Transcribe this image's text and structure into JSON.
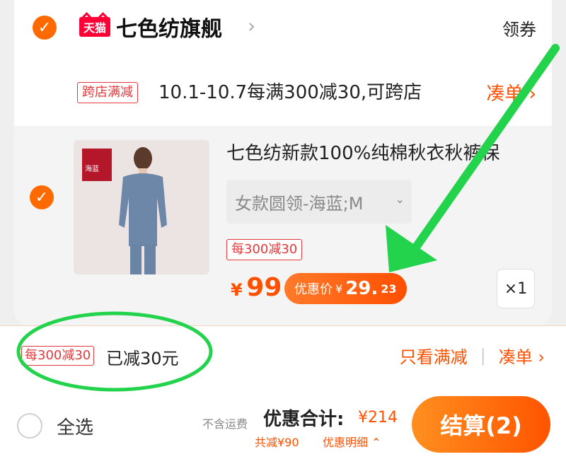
{
  "store": {
    "platform_logo": "天猫",
    "name": "七色纺旗舰",
    "coupon_label": "领券"
  },
  "promotion": {
    "tag": "跨店满减",
    "text": "10.1-10.7每满300减30,可跨店",
    "link_label": "凑单"
  },
  "item": {
    "thumb_badge": "海蓝",
    "title": "七色纺新款100%纯棉秋衣秋裤保",
    "variant": "女款圆领-海蓝;M",
    "promo_tag": "每300减30",
    "price_symbol": "¥",
    "price": "99",
    "promo_price_label": "优惠价",
    "promo_price_symbol": "¥",
    "promo_price_int": "29.",
    "promo_price_dec": "23",
    "quantity": "×1"
  },
  "summary": {
    "tag": "每300减30",
    "text": "已减30元",
    "filter_label": "只看满减",
    "add_on_label": "凑单"
  },
  "footer": {
    "select_all": "全选",
    "shipping_note": "不含运费",
    "total_label": "优惠合计:",
    "total_value": "¥214",
    "savings": "共减¥90",
    "details": "优惠明细",
    "checkout": "结算(2)"
  },
  "colors": {
    "accent": "#ff5000",
    "brand_red": "#ff0036",
    "annotation_green": "#22d34b"
  },
  "icons": {
    "store_checkbox": "check-icon",
    "item_checkbox": "check-icon",
    "store_chevron": "chevron-right-icon",
    "details_chevron": "chevron-up-icon"
  }
}
